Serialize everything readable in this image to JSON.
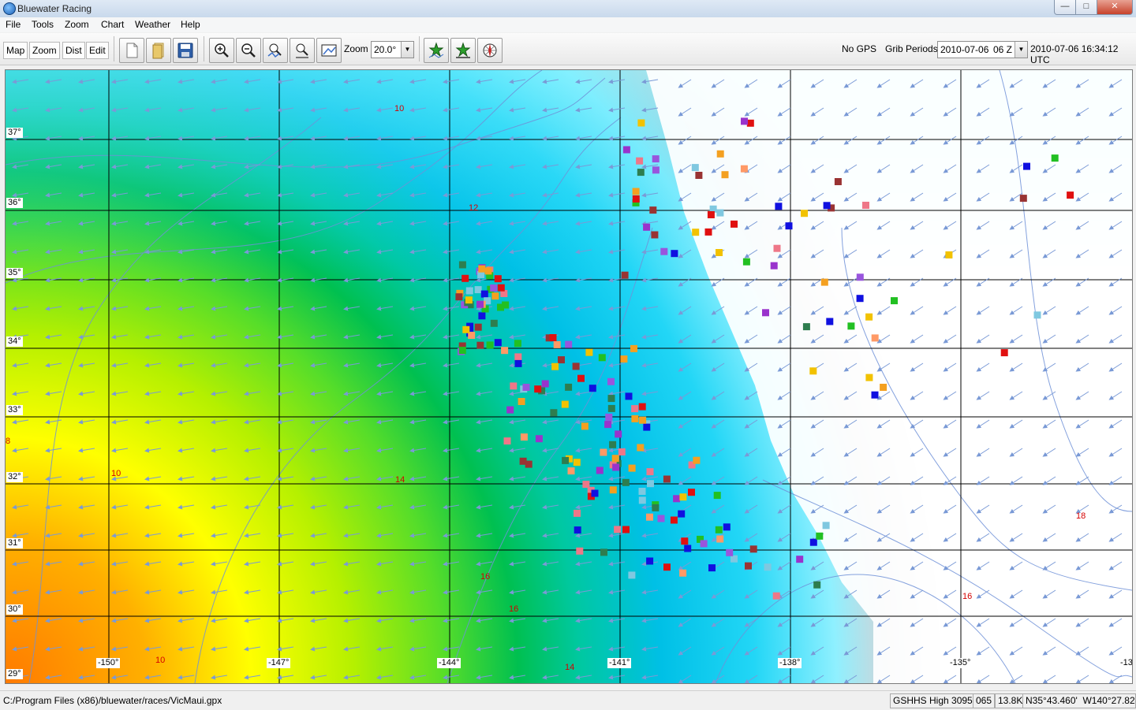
{
  "window": {
    "title": "Bluewater Racing"
  },
  "menu": [
    "File",
    "Tools",
    "Zoom",
    "Chart",
    "Weather",
    "Help"
  ],
  "toolbar": {
    "modes": [
      "Map",
      "Zoom",
      "Dist",
      "Edit"
    ],
    "zoom_label": "Zoom",
    "zoom_value": "20.0°",
    "gps_status": "No GPS",
    "grib_label": "Grib Periods",
    "grib_date": "2010-07-06",
    "grib_hour": "06 Z",
    "datetime": "2010-07-06 16:34:12 UTC",
    "icons": [
      "new-file-icon",
      "open-folder-icon",
      "save-disk-icon",
      "zoom-in-icon",
      "zoom-out-icon",
      "zoom-route-icon",
      "zoom-track-icon",
      "zoom-extent-icon",
      "add-waypoint-icon",
      "route-star-icon",
      "compass-rose-icon"
    ]
  },
  "map": {
    "lat_labels": [
      "37°",
      "36°",
      "35°",
      "34°",
      "33°",
      "32°",
      "31°",
      "30°",
      "29°"
    ],
    "lon_labels": [
      "-150°",
      "-147°",
      "-144°",
      "-141°",
      "-138°",
      "-135°",
      "-13"
    ],
    "contour_labels": [
      "10",
      "12",
      "14",
      "16",
      "16",
      "14",
      "10",
      "10",
      "16",
      "18",
      "8"
    ]
  },
  "status": {
    "path": "C:/Program Files (x86)/bluewater/races/VicMaui.gpx",
    "coastline": "GSHHS High 3095",
    "bearing": "065",
    "distance": "13.8K",
    "position": "N35°43.460'  W140°27.824'"
  }
}
